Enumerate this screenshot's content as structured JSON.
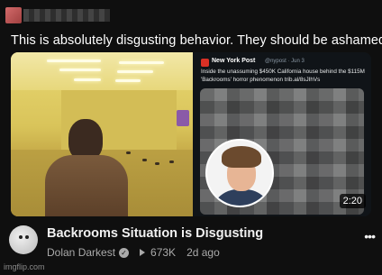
{
  "post": {
    "caption": "This is absolutely disgusting behavior. They should be ashamed."
  },
  "thumbnail": {
    "tweet": {
      "account": "New York Post",
      "meta": "@nypost · Jun 3",
      "text": "Inside the unassuming $450K California house behind the $115M 'Backrooms' horror phenomenon trib.al/8sJIhVs"
    },
    "duration": "2:20"
  },
  "video": {
    "title": "Backrooms Situation is Disgusting",
    "channel": "Dolan Darkest",
    "views": "673K",
    "age": "2d ago",
    "more_label": "•••"
  },
  "watermark": "imgflip.com",
  "colors": {
    "background": "#0f0f0f",
    "text_primary": "#f1f1f1",
    "text_secondary": "#aaaaaa"
  }
}
